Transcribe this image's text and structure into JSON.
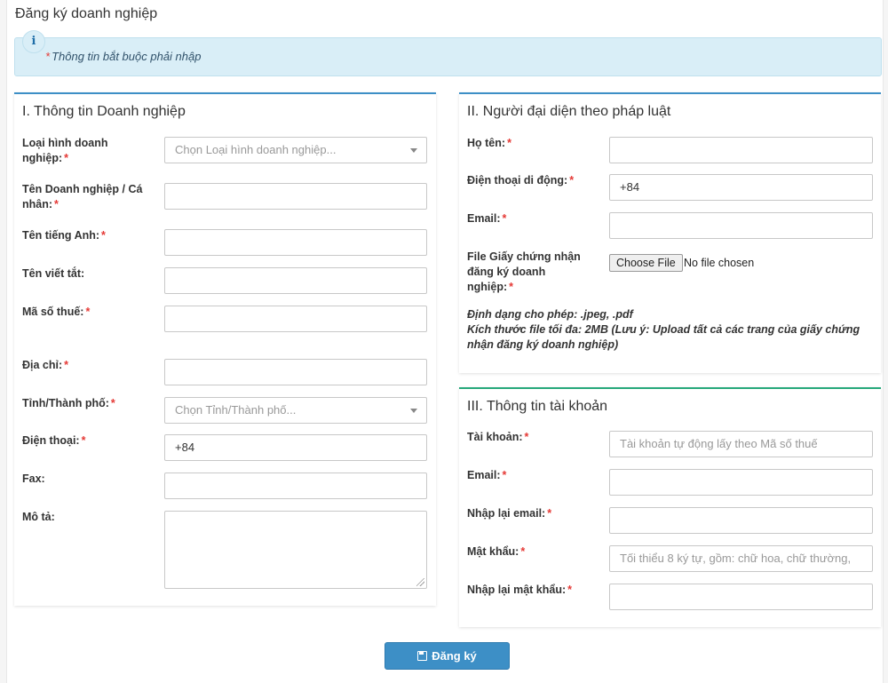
{
  "page": {
    "title": "Đăng ký doanh nghiệp"
  },
  "alert": {
    "icon": "info-icon",
    "icon_glyph": "i",
    "star": "*",
    "text": "Thông tin bắt buộc phải nhập"
  },
  "required_mark": "*",
  "section1": {
    "title": "I. Thông tin Doanh nghiệp",
    "business_type": {
      "label": "Loại hình doanh nghiệp:",
      "placeholder": "Chọn Loại hình doanh nghiệp..."
    },
    "company_name": {
      "label": "Tên Doanh nghiệp / Cá nhân:",
      "value": ""
    },
    "english_name": {
      "label": "Tên tiếng Anh:",
      "value": ""
    },
    "short_name": {
      "label": "Tên viết tắt:",
      "value": ""
    },
    "tax_code": {
      "label": "Mã số thuế:",
      "value": ""
    },
    "address": {
      "label": "Địa chỉ:",
      "value": ""
    },
    "province": {
      "label": "Tỉnh/Thành phố:",
      "placeholder": "Chọn Tỉnh/Thành phố..."
    },
    "phone": {
      "label": "Điện thoại:",
      "value": "+84"
    },
    "fax": {
      "label": "Fax:",
      "value": ""
    },
    "description": {
      "label": "Mô tả:",
      "value": ""
    }
  },
  "section2": {
    "title": "II. Người đại diện theo pháp luật",
    "full_name": {
      "label": "Họ tên:",
      "value": ""
    },
    "mobile": {
      "label": "Điện thoại di động:",
      "value": "+84"
    },
    "email": {
      "label": "Email:",
      "value": ""
    },
    "certificate": {
      "label": "File Giấy chứng nhận đăng ký doanh nghiệp:",
      "button": "Choose File",
      "status": "No file chosen"
    },
    "note_formats": "Định dạng cho phép: .jpeg, .pdf",
    "note_size": "Kích thước file tối đa: 2MB (Lưu ý: Upload tất cả các trang của giấy chứng nhận đăng ký doanh nghiệp)"
  },
  "section3": {
    "title": "III. Thông tin tài khoản",
    "account": {
      "label": "Tài khoản:",
      "placeholder": "Tài khoản tự động lấy theo Mã số thuế"
    },
    "email": {
      "label": "Email:",
      "value": ""
    },
    "email_confirm": {
      "label": "Nhập lại email:",
      "value": ""
    },
    "password": {
      "label": "Mật khẩu:",
      "placeholder": "Tối thiểu 8 ký tự, gồm: chữ hoa, chữ thường,"
    },
    "password_confirm": {
      "label": "Nhập lại mật khẩu:",
      "value": ""
    }
  },
  "submit": {
    "label": "Đăng ký",
    "icon": "save-icon"
  },
  "colors": {
    "primary": "#3d8fc6",
    "green": "#27a87b",
    "alert_bg": "#d9eef7",
    "required": "#e53935"
  }
}
